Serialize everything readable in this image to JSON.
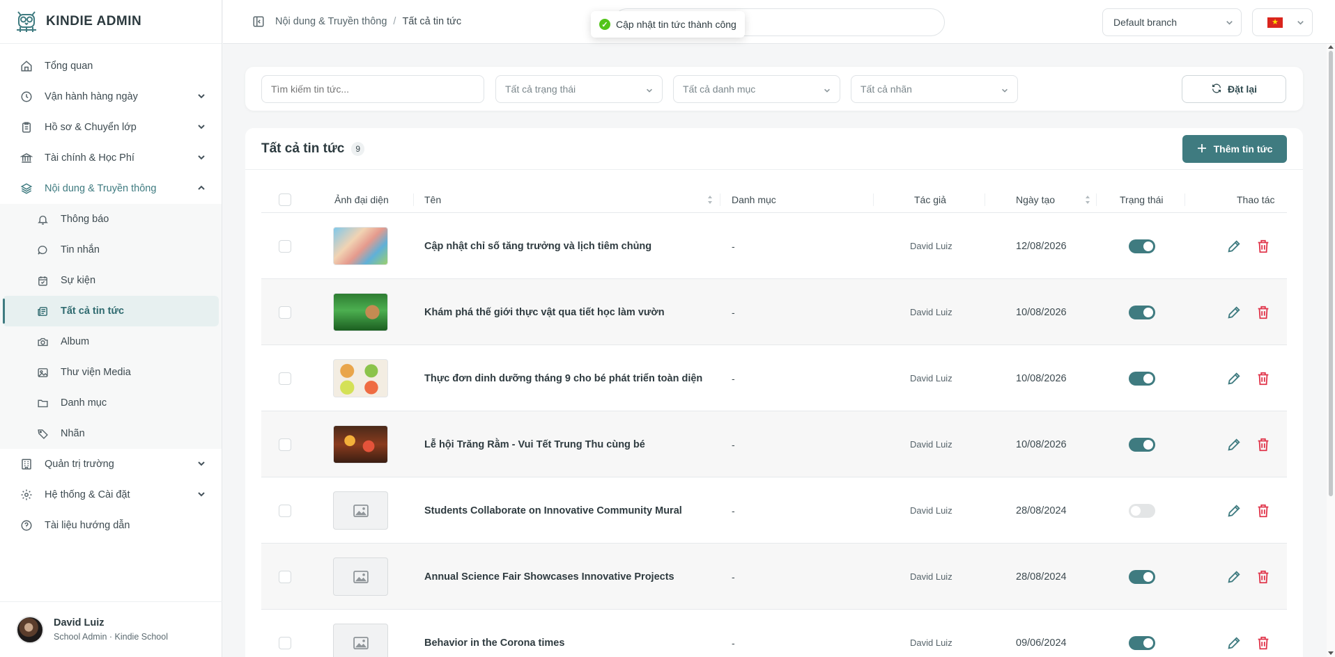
{
  "brand": {
    "name": "KINDIE ADMIN",
    "logo_icon": "owl-logo-icon"
  },
  "sidebar": {
    "items": [
      {
        "label": "Tổng quan",
        "icon": "home-icon",
        "has_chevron": false
      },
      {
        "label": "Vận hành hàng ngày",
        "icon": "clock-icon",
        "has_chevron": true
      },
      {
        "label": "Hồ sơ & Chuyển lớp",
        "icon": "clipboard-icon",
        "has_chevron": true
      },
      {
        "label": "Tài chính & Học Phí",
        "icon": "bank-icon",
        "has_chevron": true
      },
      {
        "label": "Nội dung & Truyền thông",
        "icon": "layers-icon",
        "has_chevron": true,
        "expanded": true
      }
    ],
    "subitems": [
      {
        "label": "Thông báo",
        "icon": "bell-icon"
      },
      {
        "label": "Tin nhắn",
        "icon": "message-icon"
      },
      {
        "label": "Sự kiện",
        "icon": "calendar-check-icon"
      },
      {
        "label": "Tất cả tin tức",
        "icon": "newspaper-icon",
        "active": true
      },
      {
        "label": "Album",
        "icon": "camera-icon"
      },
      {
        "label": "Thư viện Media",
        "icon": "image-icon"
      },
      {
        "label": "Danh mục",
        "icon": "folder-icon"
      },
      {
        "label": "Nhãn",
        "icon": "tag-icon"
      }
    ],
    "bottom_items": [
      {
        "label": "Quản trị trường",
        "icon": "building-icon",
        "has_chevron": true
      },
      {
        "label": "Hệ thống & Cài đặt",
        "icon": "gear-icon",
        "has_chevron": true
      },
      {
        "label": "Tài liệu hướng dẫn",
        "icon": "help-circle-icon",
        "has_chevron": false
      }
    ]
  },
  "user": {
    "name": "David Luiz",
    "role": "School Admin · Kindie School"
  },
  "header": {
    "breadcrumb": [
      "Nội dung & Truyền thông",
      "Tất cả tin tức"
    ],
    "branch": "Default branch",
    "language_flag": "vietnam-flag-icon"
  },
  "toast": {
    "message": "Cập nhật tin tức thành công",
    "icon": "check-circle-icon"
  },
  "filters": {
    "search_placeholder": "Tìm kiếm tin tức...",
    "status": "Tất cả trạng thái",
    "category": "Tất cả danh mục",
    "tag": "Tất cả nhãn",
    "reset_label": "Đặt lại"
  },
  "list": {
    "title": "Tất cả tin tức",
    "count": "9",
    "add_label": "Thêm tin tức",
    "columns": {
      "thumb": "Ảnh đại diện",
      "name": "Tên",
      "category": "Danh mục",
      "author": "Tác giả",
      "created": "Ngày tạo",
      "status": "Trạng thái",
      "actions": "Thao tác"
    },
    "rows": [
      {
        "thumb": "kids-photo",
        "title": "Cập nhật chỉ số tăng trưởng và lịch tiêm chủng",
        "category": "-",
        "author": "David Luiz",
        "date": "12/08/2026",
        "published": true
      },
      {
        "thumb": "plants-photo",
        "title": "Khám phá thế giới thực vật qua tiết học làm vườn",
        "category": "-",
        "author": "David Luiz",
        "date": "10/08/2026",
        "published": true
      },
      {
        "thumb": "food-photo",
        "title": "Thực đơn dinh dưỡng tháng 9 cho bé phát triển toàn diện",
        "category": "-",
        "author": "David Luiz",
        "date": "10/08/2026",
        "published": true
      },
      {
        "thumb": "lantern-photo",
        "title": "Lễ hội Trăng Rằm - Vui Tết Trung Thu cùng bé",
        "category": "-",
        "author": "David Luiz",
        "date": "10/08/2026",
        "published": true
      },
      {
        "thumb": "placeholder",
        "title": "Students Collaborate on Innovative Community Mural",
        "category": "-",
        "author": "David Luiz",
        "date": "28/08/2024",
        "published": false
      },
      {
        "thumb": "placeholder",
        "title": "Annual Science Fair Showcases Innovative Projects",
        "category": "-",
        "author": "David Luiz",
        "date": "28/08/2024",
        "published": true
      },
      {
        "thumb": "placeholder",
        "title": "Behavior in the Corona times",
        "category": "-",
        "author": "David Luiz",
        "date": "09/06/2024",
        "published": true
      }
    ]
  },
  "colors": {
    "primary": "#3f7b80",
    "danger": "#e0344a",
    "success": "#52c41a"
  }
}
